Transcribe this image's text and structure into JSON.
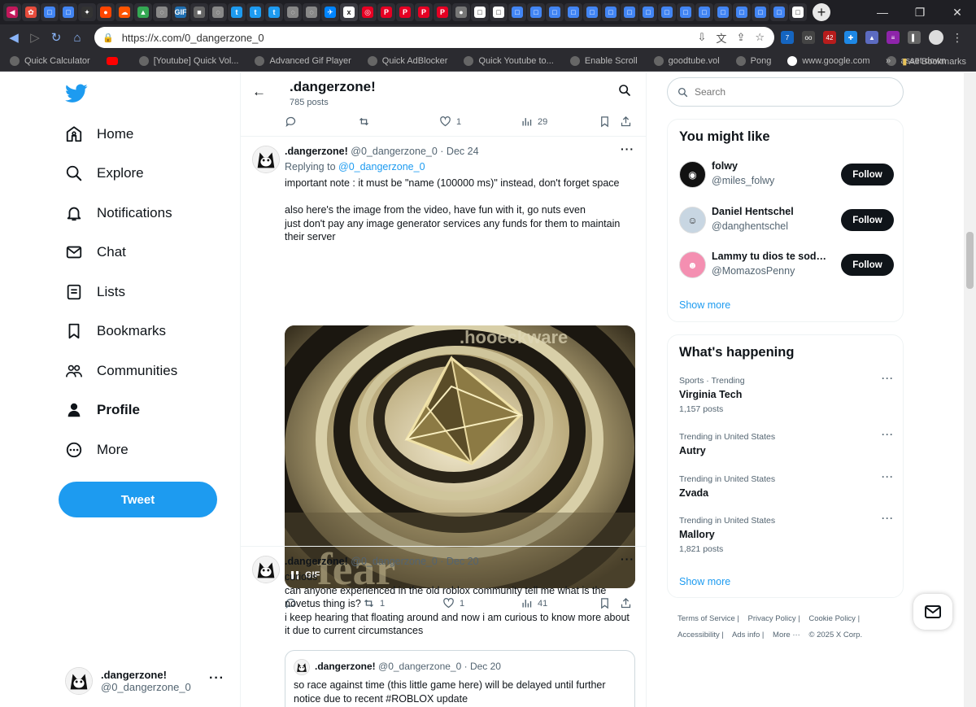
{
  "browser": {
    "url": "https://x.com/0_dangerzone_0",
    "tabs": [
      {
        "color": "#c2185b",
        "glyph": "◀"
      },
      {
        "color": "#e74c3c",
        "glyph": "✿"
      },
      {
        "color": "#4285f4",
        "glyph": "□"
      },
      {
        "color": "#4285f4",
        "glyph": "□"
      },
      {
        "color": "#333",
        "glyph": "✦"
      },
      {
        "color": "#ff4500",
        "glyph": "●"
      },
      {
        "color": "#ff5500",
        "glyph": "☁"
      },
      {
        "color": "#34a853",
        "glyph": "▲"
      },
      {
        "color": "#888",
        "glyph": "◌"
      },
      {
        "color": "#1f6fb2",
        "glyph": "GIF"
      },
      {
        "color": "#666",
        "glyph": "■"
      },
      {
        "color": "#888",
        "glyph": "◌"
      },
      {
        "color": "#1d9bf0",
        "glyph": "t"
      },
      {
        "color": "#1d9bf0",
        "glyph": "t"
      },
      {
        "color": "#1d9bf0",
        "glyph": "t"
      },
      {
        "color": "#888",
        "glyph": "◌"
      },
      {
        "color": "#888",
        "glyph": "◌"
      },
      {
        "color": "#0085ff",
        "glyph": "✈"
      },
      {
        "color": "#fff",
        "glyph": "x"
      },
      {
        "color": "#e60023",
        "glyph": "◎"
      },
      {
        "color": "#e60023",
        "glyph": "P"
      },
      {
        "color": "#e60023",
        "glyph": "P"
      },
      {
        "color": "#e60023",
        "glyph": "P"
      },
      {
        "color": "#e60023",
        "glyph": "P"
      },
      {
        "color": "#777",
        "glyph": "●"
      },
      {
        "color": "#fff",
        "glyph": "□"
      },
      {
        "color": "#fff",
        "glyph": "□"
      },
      {
        "color": "#4285f4",
        "glyph": "□"
      },
      {
        "color": "#4285f4",
        "glyph": "□"
      },
      {
        "color": "#4285f4",
        "glyph": "□"
      },
      {
        "color": "#4285f4",
        "glyph": "□"
      },
      {
        "color": "#4285f4",
        "glyph": "□"
      },
      {
        "color": "#4285f4",
        "glyph": "□"
      },
      {
        "color": "#4285f4",
        "glyph": "□"
      },
      {
        "color": "#4285f4",
        "glyph": "□"
      },
      {
        "color": "#4285f4",
        "glyph": "□"
      },
      {
        "color": "#4285f4",
        "glyph": "□"
      },
      {
        "color": "#4285f4",
        "glyph": "□"
      },
      {
        "color": "#4285f4",
        "glyph": "□"
      },
      {
        "color": "#4285f4",
        "glyph": "□"
      },
      {
        "color": "#4285f4",
        "glyph": "□"
      },
      {
        "color": "#4285f4",
        "glyph": "□"
      },
      {
        "color": "#fff",
        "glyph": "□"
      }
    ],
    "extensions": [
      {
        "color": "#1565c0",
        "label": "7"
      },
      {
        "color": "#444",
        "label": "oo"
      },
      {
        "color": "#b71c1c",
        "label": "42"
      },
      {
        "color": "#1e88e5",
        "label": "✚"
      },
      {
        "color": "#5c6bc0",
        "label": "▲"
      },
      {
        "color": "#8e24aa",
        "label": "≡"
      },
      {
        "color": "#666",
        "label": "▌"
      }
    ],
    "bookmarks": [
      "Quick Calculator",
      "",
      "[Youtube] Quick Vol...",
      "Advanced Gif Player",
      "Quick AdBlocker",
      "Quick Youtube to...",
      "Enable Scroll",
      "goodtube.vol",
      "Pong",
      "www.google.com",
      "asset down"
    ],
    "bookmarks_more": "»",
    "all_bookmarks": "All Bookmarks"
  },
  "nav": {
    "items": [
      {
        "label": "Home",
        "icon": "home-icon"
      },
      {
        "label": "Explore",
        "icon": "search-icon"
      },
      {
        "label": "Notifications",
        "icon": "bell-icon"
      },
      {
        "label": "Chat",
        "icon": "mail-icon"
      },
      {
        "label": "Lists",
        "icon": "list-icon"
      },
      {
        "label": "Bookmarks",
        "icon": "bookmark-icon"
      },
      {
        "label": "Communities",
        "icon": "communities-icon"
      },
      {
        "label": "Profile",
        "icon": "profile-icon"
      },
      {
        "label": "More",
        "icon": "more-circle-icon"
      }
    ],
    "tweet_label": "Tweet",
    "account": {
      "name": ".dangerzone!",
      "handle": "@0_dangerzone_0"
    }
  },
  "profile_header": {
    "title": ".dangerzone!",
    "count": "785 posts"
  },
  "top_actions": {
    "replies": "",
    "retweets": "",
    "likes": "1",
    "views": "29"
  },
  "posts": [
    {
      "name": ".dangerzone!",
      "handle": "@0_dangerzone_0",
      "date": "· Dec 24",
      "replying_prefix": "Replying to ",
      "replying_to": "@0_dangerzone_0",
      "lines": [
        "important note : it must be \"name (100000 ms)\" instead, don't forget space",
        "",
        "also here's the image from the video, have fun with it, go nuts even",
        "just don't pay any image generator services any funds for them to maintain their server"
      ],
      "media_badge": "GIF",
      "actions": {
        "replies": "",
        "retweets": "1",
        "likes": "1",
        "views": "41"
      }
    },
    {
      "name": ".dangerzone!",
      "handle": "@0_dangerzone_0",
      "date": "· Dec 20",
      "lines": [
        "curious",
        "can anyone experienced in the old roblox community tell me what is the novetus thing is?",
        "i keep hearing that floating around and now i am curious to know more about it due to current circumstances"
      ],
      "quote": {
        "name": ".dangerzone!",
        "handle": "@0_dangerzone_0",
        "date": "· Dec 20",
        "text": "so race against time (this little game here) will be delayed until further notice due to recent #ROBLOX update"
      }
    }
  ],
  "search": {
    "placeholder": "Search"
  },
  "suggestions": {
    "title": "You might like",
    "users": [
      {
        "name": "folwy",
        "handle": "@miles_folwy",
        "avatar_color": "#111"
      },
      {
        "name": "Daniel Hentschel",
        "handle": "@danghentschel",
        "avatar_color": "#9fb6c8"
      },
      {
        "name": "Lammy tu dios te sodomiza",
        "handle": "@MomazosPenny",
        "avatar_color": "#f06292"
      }
    ],
    "follow_label": "Follow",
    "show_more": "Show more"
  },
  "happening": {
    "title": "What's happening",
    "trends": [
      {
        "category": "Sports · Trending",
        "topic": "Virginia Tech",
        "posts": "1,157 posts"
      },
      {
        "category": "Trending in United States",
        "topic": "Autry",
        "posts": ""
      },
      {
        "category": "Trending in United States",
        "topic": "Zvada",
        "posts": ""
      },
      {
        "category": "Trending in United States",
        "topic": "Mallory",
        "posts": "1,821 posts"
      }
    ],
    "show_more": "Show more"
  },
  "footer": {
    "links": [
      "Terms of Service |",
      "Privacy Policy |",
      "Cookie Policy |",
      "Accessibility |",
      "Ads info |",
      "More ···",
      "© 2025 X Corp."
    ]
  },
  "colors": {
    "accent": "#1d9bf0",
    "text": "#0f1419",
    "muted": "#536471",
    "border": "#eff3f4"
  }
}
